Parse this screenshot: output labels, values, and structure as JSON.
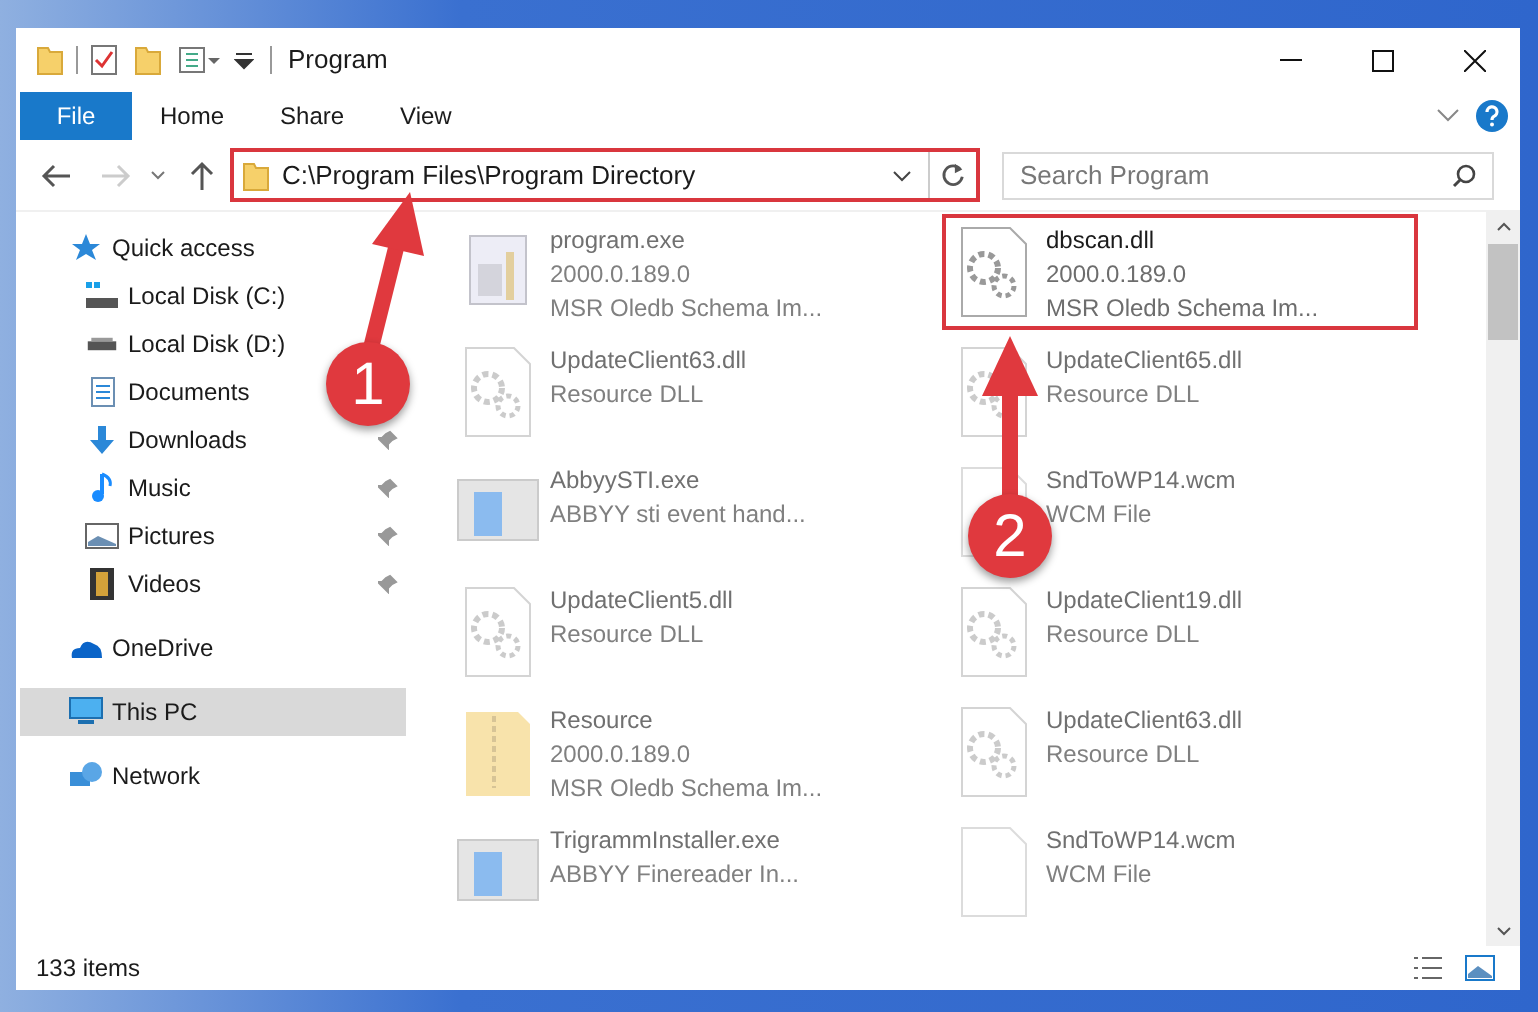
{
  "window": {
    "title": "Program"
  },
  "ribbon": {
    "file_tab": "File",
    "tabs": [
      "Home",
      "Share",
      "View"
    ]
  },
  "address": {
    "path": "C:\\Program Files\\Program Directory",
    "highlighted": true
  },
  "search": {
    "placeholder": "Search Program"
  },
  "sidebar": {
    "items": [
      {
        "label": "Quick access",
        "kind": "star",
        "selected": false,
        "children": [
          {
            "label": "Local Disk (C:)",
            "kind": "disk_c"
          },
          {
            "label": "Local Disk (D:)",
            "kind": "disk"
          },
          {
            "label": "Documents",
            "kind": "documents"
          },
          {
            "label": "Downloads",
            "kind": "downloads",
            "pinned": true
          },
          {
            "label": "Music",
            "kind": "music",
            "pinned": true
          },
          {
            "label": "Pictures",
            "kind": "pictures",
            "pinned": true
          },
          {
            "label": "Videos",
            "kind": "videos",
            "pinned": true
          }
        ]
      },
      {
        "label": "OneDrive",
        "kind": "cloud",
        "selected": false
      },
      {
        "label": "This PC",
        "kind": "pc",
        "selected": true
      },
      {
        "label": "Network",
        "kind": "network",
        "selected": false
      }
    ]
  },
  "files": [
    {
      "name": "program.exe",
      "details": [
        "2000.0.189.0",
        "MSR Oledb Schema Im..."
      ],
      "kind": "exe",
      "blurred": true,
      "highlighted": false
    },
    {
      "name": "dbscan.dll",
      "details": [
        "2000.0.189.0",
        "MSR Oledb Schema Im..."
      ],
      "kind": "dll",
      "blurred": false,
      "highlighted": true
    },
    {
      "name": "UpdateClient63.dll",
      "details": [
        "Resource DLL"
      ],
      "kind": "dll",
      "blurred": true,
      "highlighted": false
    },
    {
      "name": "UpdateClient65.dll",
      "details": [
        "Resource DLL"
      ],
      "kind": "dll",
      "blurred": true,
      "highlighted": false
    },
    {
      "name": "AbbyySTI.exe",
      "details": [
        "ABBYY sti event hand..."
      ],
      "kind": "app",
      "blurred": true,
      "highlighted": false
    },
    {
      "name": "SndToWP14.wcm",
      "details": [
        "WCM File"
      ],
      "kind": "blank",
      "blurred": true,
      "highlighted": false
    },
    {
      "name": "UpdateClient5.dll",
      "details": [
        "Resource DLL"
      ],
      "kind": "dll",
      "blurred": true,
      "highlighted": false
    },
    {
      "name": "UpdateClient19.dll",
      "details": [
        "Resource DLL"
      ],
      "kind": "dll",
      "blurred": true,
      "highlighted": false
    },
    {
      "name": "Resource",
      "details": [
        "2000.0.189.0",
        "MSR Oledb Schema Im..."
      ],
      "kind": "zip",
      "blurred": true,
      "highlighted": false
    },
    {
      "name": "UpdateClient63.dll",
      "details": [
        "Resource DLL"
      ],
      "kind": "dll",
      "blurred": true,
      "highlighted": false
    },
    {
      "name": "TrigrammInstaller.exe",
      "details": [
        "ABBYY Finereader In..."
      ],
      "kind": "app",
      "blurred": true,
      "highlighted": false
    },
    {
      "name": "SndToWP14.wcm",
      "details": [
        "WCM File"
      ],
      "kind": "blank",
      "blurred": true,
      "highlighted": false
    }
  ],
  "status_bar": {
    "count": "133 items"
  },
  "callouts": [
    {
      "number": "1"
    },
    {
      "number": "2"
    }
  ]
}
